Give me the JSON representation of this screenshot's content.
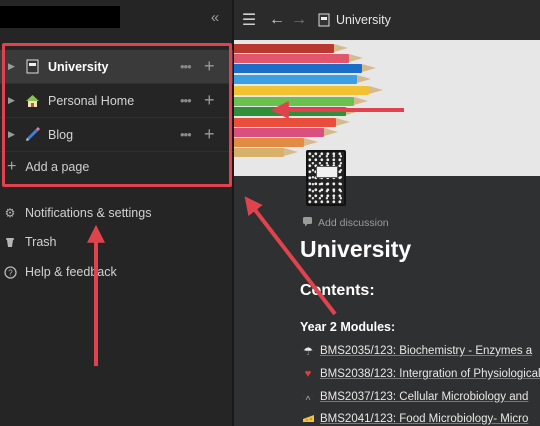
{
  "sidebar": {
    "collapse_icon": "double-chevron-left-icon",
    "pages": [
      {
        "title": "University",
        "icon": "notebook-icon",
        "active": true
      },
      {
        "title": "Personal Home",
        "icon": "house-icon",
        "active": false
      },
      {
        "title": "Blog",
        "icon": "pencil-icon",
        "active": false
      }
    ],
    "add_page": "Add a page",
    "nav": [
      {
        "label": "Notifications & settings",
        "icon": "gear-icon"
      },
      {
        "label": "Trash",
        "icon": "trash-icon"
      },
      {
        "label": "Help & feedback",
        "icon": "help-icon"
      }
    ]
  },
  "topbar": {
    "breadcrumb": "University"
  },
  "page": {
    "add_discussion": "Add discussion",
    "title": "University",
    "contents_heading": "Contents:",
    "section_heading": "Year 2  Modules:",
    "modules": [
      {
        "icon": "umbrella-icon",
        "text": "BMS2035/123: Biochemistry - Enzymes a"
      },
      {
        "icon": "broken-heart-icon",
        "text": "BMS2038/123: Intergration of Physiological"
      },
      {
        "icon": "ant-icon",
        "text": "BMS2037/123: Cellular Microbiology and"
      },
      {
        "icon": "cheese-icon",
        "text": "BMS2041/123: Food Microbiology- Micro"
      }
    ]
  },
  "colors": {
    "annotation": "#e0434d",
    "sidebar_bg": "#252525",
    "main_bg": "#2f3031"
  }
}
